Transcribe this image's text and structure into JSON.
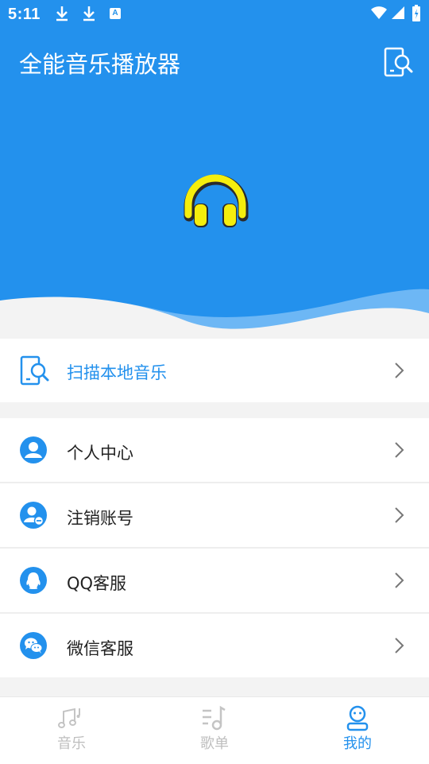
{
  "status_bar": {
    "time": "5:11",
    "badge": "A"
  },
  "header": {
    "title": "全能音乐播放器"
  },
  "scan_row": {
    "label": "扫描本地音乐"
  },
  "menu": [
    {
      "label": "个人中心"
    },
    {
      "label": "注销账号"
    },
    {
      "label": "QQ客服"
    },
    {
      "label": "微信客服"
    }
  ],
  "tabs": [
    {
      "label": "音乐",
      "icon": "music-note-icon"
    },
    {
      "label": "歌单",
      "icon": "playlist-icon"
    },
    {
      "label": "我的",
      "icon": "profile-icon",
      "active": true
    }
  ],
  "colors": {
    "primary": "#2391ed",
    "accent_yellow": "#f5ee0d",
    "background": "#f3f3f3"
  }
}
